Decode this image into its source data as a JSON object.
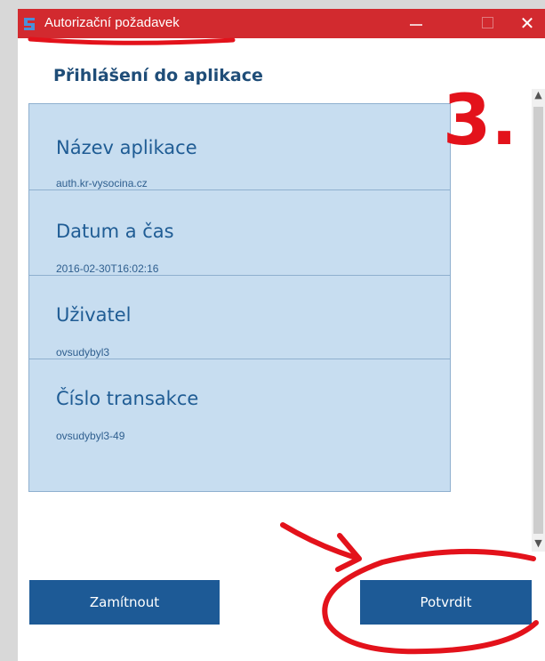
{
  "window": {
    "title": "Autorizační požadavek",
    "close_glyph": "✕"
  },
  "heading": "Přihlášení do aplikace",
  "fields": [
    {
      "label": "Název aplikace",
      "value": "auth.kr-vysocina.cz"
    },
    {
      "label": "Datum a čas",
      "value": "2016-02-30T16:02:16"
    },
    {
      "label": "Uživatel",
      "value": "ovsudybyl3"
    },
    {
      "label": "Číslo transakce",
      "value": "ovsudybyl3-49"
    }
  ],
  "buttons": {
    "reject": "Zamítnout",
    "confirm": "Potvrdit"
  },
  "annotation": {
    "step_number": "3."
  },
  "colors": {
    "titlebar": "#d22a2f",
    "accent": "#1d5a96",
    "panel": "#c7ddf0",
    "marker": "#e3121b"
  }
}
